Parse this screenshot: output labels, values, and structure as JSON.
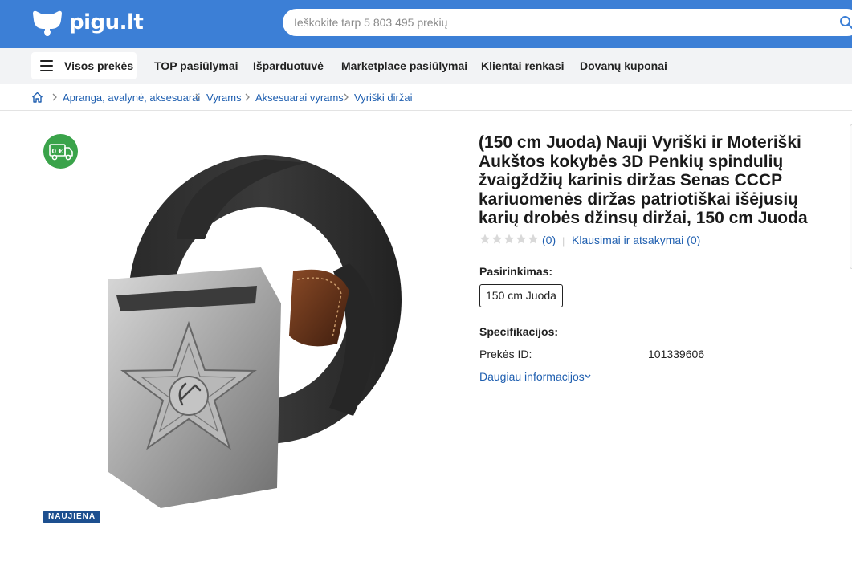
{
  "header": {
    "logo_text": "pigu.lt",
    "search_placeholder": "Ieškokite tarp 5 803 495 prekių"
  },
  "nav": {
    "all_products": "Visos prekės",
    "items": [
      "TOP pasiūlymai",
      "Išparduotuvė",
      "Marketplace pasiūlymai",
      "Klientai renkasi",
      "Dovanų kuponai"
    ]
  },
  "breadcrumb": [
    "Apranga, avalynė, aksesuarai",
    "Vyrams",
    "Aksesuarai vyrams",
    "Vyriški diržai"
  ],
  "product": {
    "free_delivery_label": "0 €",
    "new_tag": "NAUJIENA",
    "title": "(150 cm Juoda) Nauji Vyriški ir Moteriški Aukštos kokybės 3D Penkių spindulių žvaigždžių karinis diržas Senas CCCP kariuomenės diržas patriotiškai išėjusių karių drobės džinsų diržai, 150 cm Juoda",
    "rating_value": 0,
    "rating_count": "(0)",
    "qa_link": "Klausimai ir atsakymai (0)",
    "selection_label": "Pasirinkimas:",
    "selected_option": "150 cm Juoda",
    "specs_label": "Specifikacijos:",
    "spec_key": "Prekės ID:",
    "spec_value": "101339606",
    "more_info": "Daugiau informacijos"
  },
  "colors": {
    "brand_blue": "#3c7fd6",
    "link": "#1f5fb0",
    "free_badge": "#3aa34a",
    "new_tag": "#1d4f8f"
  }
}
